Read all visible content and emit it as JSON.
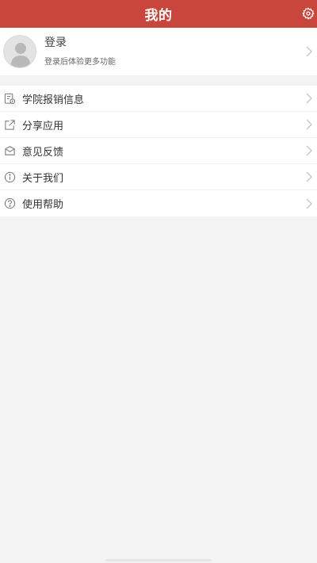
{
  "header": {
    "title": "我的",
    "settings_icon": "gear-icon",
    "bg_color": "#c8463c"
  },
  "profile": {
    "title": "登录",
    "subtitle": "登录后体验更多功能",
    "avatar_icon": "user-avatar-icon",
    "chevron_icon": "chevron-right-icon"
  },
  "menu": {
    "items": [
      {
        "label": "学院报销信息",
        "icon": "document-receipt-icon"
      },
      {
        "label": "分享应用",
        "icon": "share-icon"
      },
      {
        "label": "意见反馈",
        "icon": "envelope-icon"
      },
      {
        "label": "关于我们",
        "icon": "info-icon"
      },
      {
        "label": "使用帮助",
        "icon": "help-icon"
      }
    ]
  }
}
